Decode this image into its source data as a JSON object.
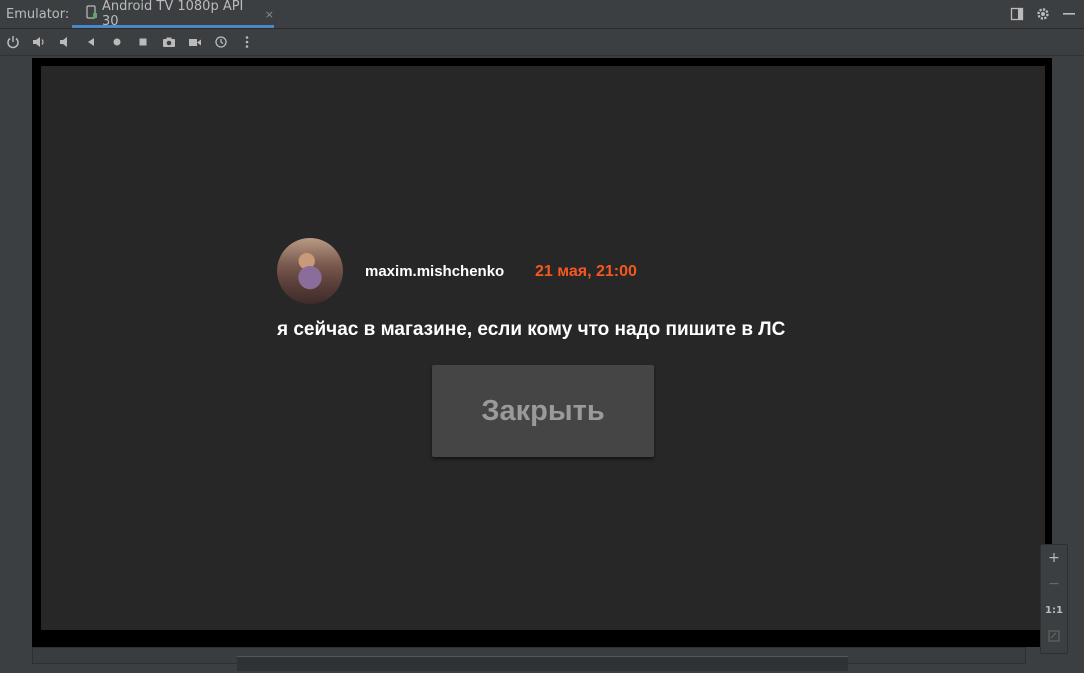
{
  "window": {
    "label": "Emulator:",
    "tab_title": "Android TV 1080p API 30",
    "tab_close": "×"
  },
  "toolbar": {
    "icons": [
      "power-icon",
      "volume-up-icon",
      "volume-down-icon",
      "back-icon",
      "home-icon",
      "overview-icon",
      "camera-icon",
      "record-icon",
      "history-icon",
      "more-icon"
    ]
  },
  "screen": {
    "username": "maxim.mishchenko",
    "timestamp": "21 мая, 21:00",
    "message": "я сейчас в магазине, если кому что надо пишите в ЛС",
    "close_button": "Закрыть"
  },
  "zoom": {
    "plus": "+",
    "minus": "−",
    "actual_size": "1:1"
  },
  "colors": {
    "accent": "#4a88c7",
    "timestamp": "#f4581f",
    "screen_bg": "#272727"
  }
}
